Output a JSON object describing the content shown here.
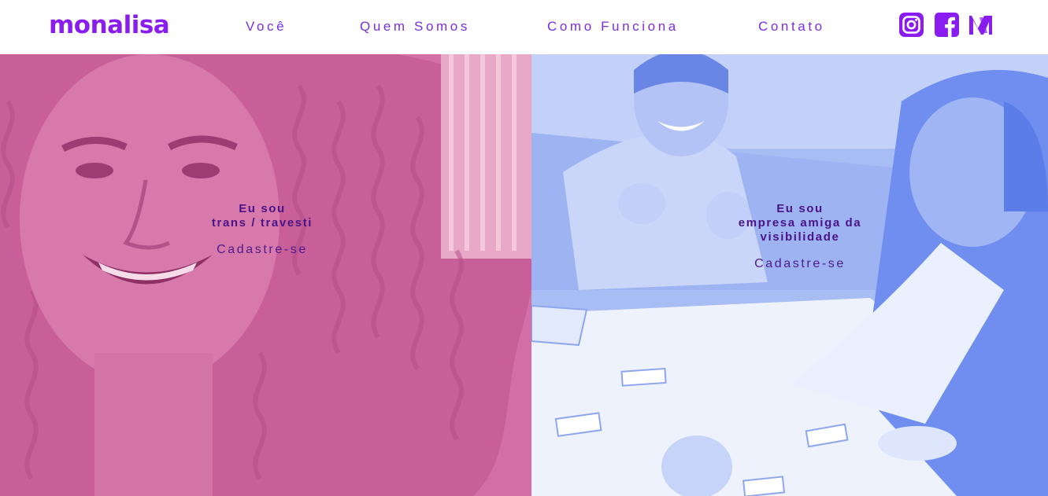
{
  "brand": {
    "logo_text": "monalisa",
    "color": "#8a1cf0"
  },
  "nav": {
    "items": [
      {
        "label": "Você"
      },
      {
        "label": "Quem Somos"
      },
      {
        "label": "Como Funciona"
      },
      {
        "label": "Contato"
      }
    ],
    "color": "#7a2ee0"
  },
  "social": {
    "icons": [
      "instagram-icon",
      "facebook-icon",
      "medium-icon"
    ],
    "color": "#8a1cf0"
  },
  "hero": {
    "left": {
      "line1": "Eu sou",
      "line2": "trans / travesti",
      "cta": "Cadastre-se",
      "tint": "#d36fa4"
    },
    "right": {
      "line1": "Eu sou",
      "line2": "empresa amiga da",
      "line3": "visibilidade",
      "cta": "Cadastre-se",
      "tint": "#a9bdf5"
    },
    "text_color": "#4a1486"
  }
}
